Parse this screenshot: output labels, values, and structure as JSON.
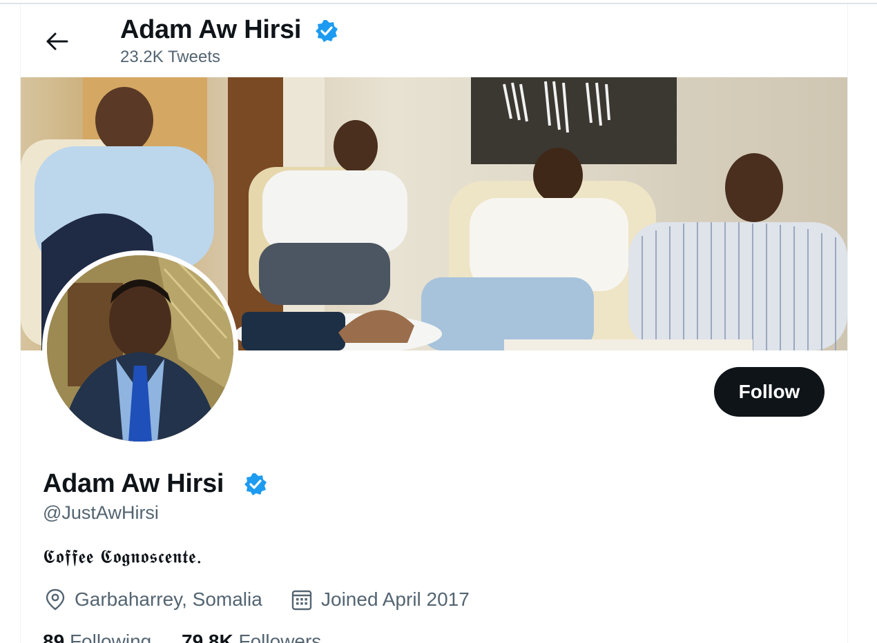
{
  "header": {
    "name": "Adam Aw Hirsi",
    "tweet_count": "23.2K Tweets"
  },
  "profile": {
    "name": "Adam Aw Hirsi",
    "handle": "@JustAwHirsi",
    "bio": "𝕮𝖔𝖋𝖋𝖊𝖊 𝕮𝖔𝖌𝖓𝖔𝖘𝖈𝖊𝖓𝖙𝖊.",
    "location": "Garbaharrey, Somalia",
    "joined": "Joined April 2017",
    "follow_label": "Follow"
  },
  "stats": {
    "following_count": "89",
    "following_label": "Following",
    "followers_count": "79.8K",
    "followers_label": "Followers"
  },
  "colors": {
    "verified": "#1d9bf0",
    "button": "#0f1419",
    "secondary_text": "#536471"
  },
  "icons": [
    "back-arrow-icon",
    "verified-badge-icon",
    "location-icon",
    "calendar-icon"
  ]
}
